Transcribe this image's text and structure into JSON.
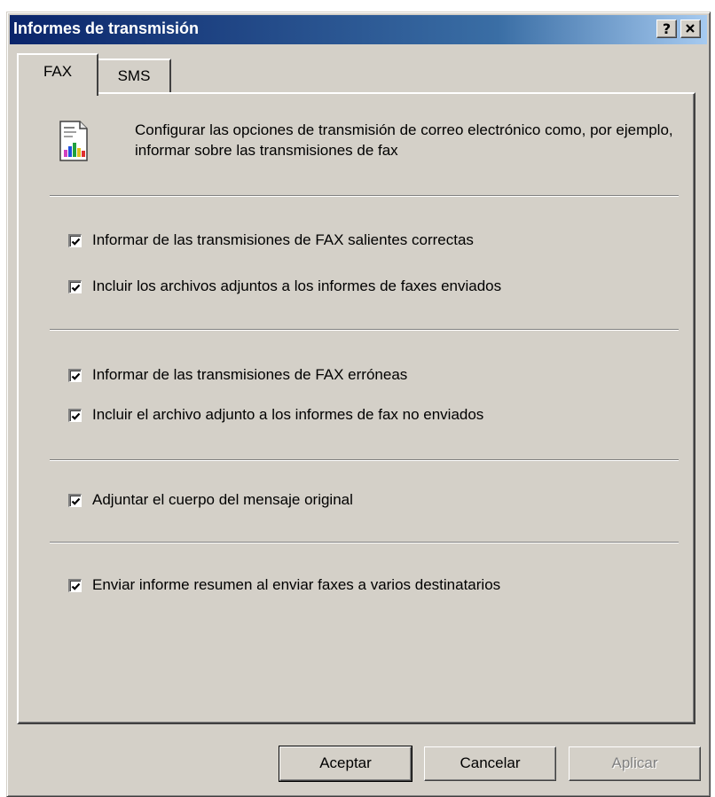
{
  "window": {
    "title": "Informes de transmisión",
    "help_label": "?",
    "close_label": "✕",
    "titlebar_color": "#0a246a"
  },
  "tabs": [
    {
      "label": "FAX",
      "selected": true
    },
    {
      "label": "SMS",
      "selected": false
    }
  ],
  "description": "Configurar las opciones de transmisión de correo electrónico como, por ejemplo, informar sobre las transmisiones de fax",
  "header_icon": "fax-report-document-icon",
  "options": [
    {
      "label": "Informar de las transmisiones de FAX salientes correctas",
      "checked": true
    },
    {
      "label": "Incluir los archivos adjuntos a los informes de faxes enviados",
      "checked": true
    },
    {
      "label": "Informar de las transmisiones de FAX erróneas",
      "checked": true
    },
    {
      "label": "Incluir el archivo adjunto a los informes de fax no enviados",
      "checked": true
    },
    {
      "label": "Adjuntar el cuerpo del mensaje original",
      "checked": true
    },
    {
      "label": "Enviar informe resumen al enviar faxes a varios destinatarios",
      "checked": true
    }
  ],
  "buttons": {
    "ok": "Aceptar",
    "cancel": "Cancelar",
    "apply": "Aplicar",
    "apply_enabled": false
  }
}
